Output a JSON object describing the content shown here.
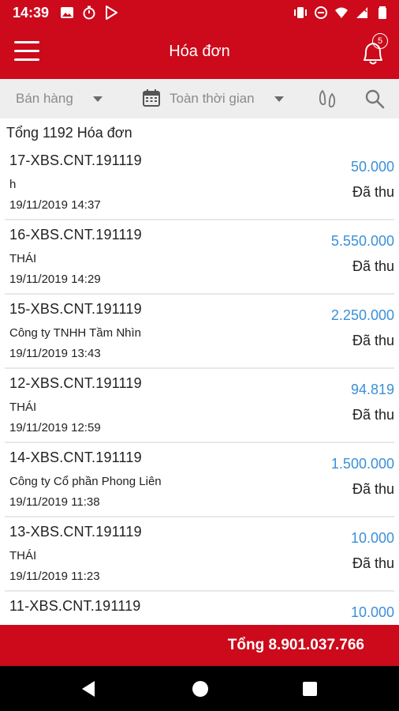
{
  "status_bar": {
    "time": "14:39",
    "left_icons": [
      "image-icon",
      "timer-icon",
      "play-store-icon"
    ],
    "right_icons": [
      "vibrate-icon",
      "do-not-disturb-icon",
      "wifi-icon",
      "no-signal-icon",
      "battery-icon"
    ]
  },
  "app_bar": {
    "title": "Hóa đơn",
    "notification_count": "5",
    "color": "#cc0a1b"
  },
  "filters": {
    "sales_label": "Bán hàng",
    "time_label": "Toàn thời gian"
  },
  "summary": {
    "total_count_label": "Tổng 1192 Hóa đơn"
  },
  "invoices": [
    {
      "code": "17-XBS.CNT.191119",
      "customer": "h",
      "date": "19/11/2019 14:37",
      "amount": "50.000",
      "status": "Đã thu"
    },
    {
      "code": "16-XBS.CNT.191119",
      "customer": "THÁI",
      "date": "19/11/2019 14:29",
      "amount": "5.550.000",
      "status": "Đã thu"
    },
    {
      "code": "15-XBS.CNT.191119",
      "customer": "Công ty TNHH Tầm Nhìn",
      "date": "19/11/2019 13:43",
      "amount": "2.250.000",
      "status": "Đã thu"
    },
    {
      "code": "12-XBS.CNT.191119",
      "customer": "THÁI",
      "date": "19/11/2019 12:59",
      "amount": "94.819",
      "status": "Đã thu"
    },
    {
      "code": "14-XBS.CNT.191119",
      "customer": "Công ty Cổ phần Phong Liên",
      "date": "19/11/2019 11:38",
      "amount": "1.500.000",
      "status": "Đã thu"
    },
    {
      "code": "13-XBS.CNT.191119",
      "customer": "THÁI",
      "date": "19/11/2019 11:23",
      "amount": "10.000",
      "status": "Đã thu"
    },
    {
      "code": "11-XBS.CNT.191119",
      "customer": "",
      "date": "",
      "amount": "10.000",
      "status": ""
    }
  ],
  "footer": {
    "total_label": "Tổng 8.901.037.766"
  },
  "colors": {
    "primary": "#cc0a1b",
    "amount": "#3b8fd9"
  }
}
